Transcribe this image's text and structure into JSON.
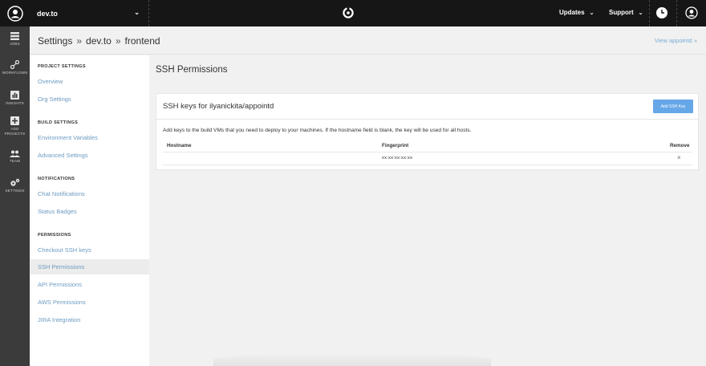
{
  "topbar": {
    "org_name": "dev.to",
    "menus": [
      {
        "label": "Updates"
      },
      {
        "label": "Support"
      }
    ]
  },
  "leftnav": {
    "items": [
      {
        "label": "JOBS",
        "icon": "list-icon"
      },
      {
        "label": "WORKFLOWS",
        "icon": "workflows-icon"
      },
      {
        "label": "INSIGHTS",
        "icon": "insights-icon"
      },
      {
        "label": "ADD PROJECTS",
        "icon": "add-projects-icon"
      },
      {
        "label": "TEAM",
        "icon": "team-icon"
      },
      {
        "label": "SETTINGS",
        "icon": "gears-icon"
      }
    ]
  },
  "header": {
    "crumb_settings": "Settings",
    "crumb_sep": "»",
    "crumb_org": "dev.to",
    "crumb_project": "frontend",
    "view_link": "View appointd »"
  },
  "sidebar": {
    "sections": [
      {
        "title": "PROJECT SETTINGS",
        "items": [
          "Overview",
          "Org Settings"
        ]
      },
      {
        "title": "BUILD SETTINGS",
        "items": [
          "Environment Variables",
          "Advanced Settings"
        ]
      },
      {
        "title": "NOTIFICATIONS",
        "items": [
          "Chat Notifications",
          "Status Badges"
        ]
      },
      {
        "title": "PERMISSIONS",
        "items": [
          "Checkout SSH keys",
          "SSH Permissions",
          "API Permissions",
          "AWS Permissions",
          "JIRA Integration"
        ]
      }
    ],
    "active_item": "SSH Permissions"
  },
  "main": {
    "page_title": "SSH Permissions",
    "card_title": "SSH keys for ilyanickita/appointd",
    "add_button": "Add SSH Key",
    "description": "Add keys to the build VMs that you need to deploy to your machines. If the hostname field is blank, the key will be used for all hosts.",
    "columns": [
      "Hostname",
      "Fingerprint",
      "Remove"
    ],
    "rows": [
      {
        "hostname": "",
        "fingerprint": "xx:xx:xx:xx:xx",
        "remove": "×"
      }
    ]
  },
  "colors": {
    "topbar": "#161616",
    "leftnav": "#3b3b3b",
    "link": "#6c9bc2",
    "button": "#66a7e8"
  }
}
